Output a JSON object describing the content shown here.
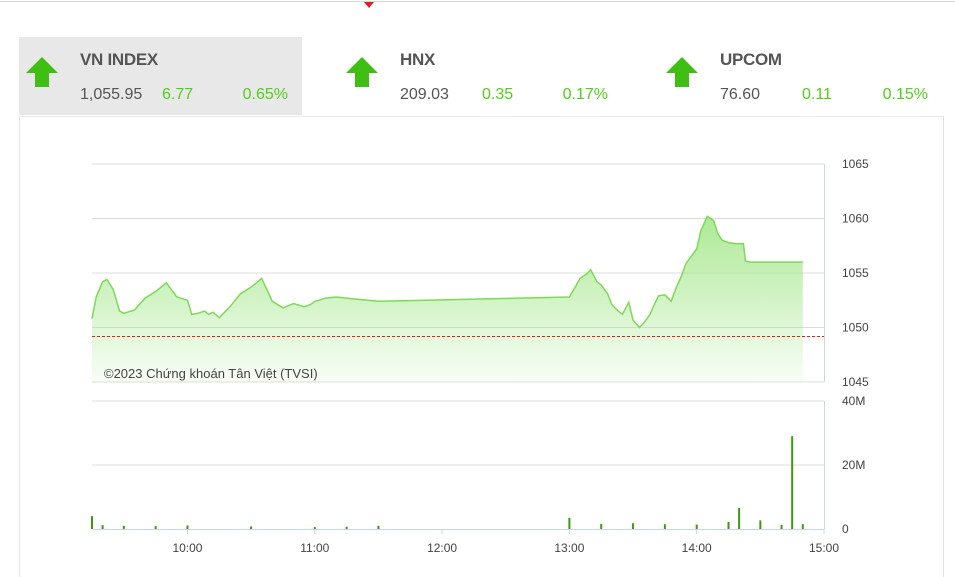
{
  "indices": [
    {
      "name": "VN INDEX",
      "value": "1,055.95",
      "change": "6.77",
      "percent": "0.65%",
      "direction": "up",
      "active": true
    },
    {
      "name": "HNX",
      "value": "209.03",
      "change": "0.35",
      "percent": "0.17%",
      "direction": "up",
      "active": false
    },
    {
      "name": "UPCOM",
      "value": "76.60",
      "change": "0.11",
      "percent": "0.15%",
      "direction": "up",
      "active": false
    }
  ],
  "colors": {
    "up": "#55cc1e",
    "arrow": "#3fbf12",
    "line": "#7ed957",
    "fill": "#c8f0b4",
    "reference": "#e02020",
    "volume": "#3a9a12"
  },
  "chart_data": [
    {
      "type": "area",
      "series_name": "VN INDEX",
      "x": [
        "09:15",
        "09:17",
        "09:20",
        "09:22",
        "09:25",
        "09:28",
        "09:30",
        "09:35",
        "09:40",
        "09:45",
        "09:50",
        "09:55",
        "10:00",
        "10:02",
        "10:05",
        "10:08",
        "10:10",
        "10:12",
        "10:15",
        "10:20",
        "10:25",
        "10:30",
        "10:35",
        "10:40",
        "10:45",
        "10:50",
        "10:55",
        "10:58",
        "11:00",
        "11:02",
        "11:05",
        "11:10",
        "11:15",
        "11:20",
        "11:25",
        "11:30",
        "13:00",
        "13:03",
        "13:05",
        "13:08",
        "13:10",
        "13:13",
        "13:15",
        "13:18",
        "13:20",
        "13:23",
        "13:25",
        "13:28",
        "13:30",
        "13:33",
        "13:35",
        "13:38",
        "13:40",
        "13:42",
        "13:45",
        "13:48",
        "13:50",
        "13:53",
        "13:55",
        "14:00",
        "14:02",
        "14:05",
        "14:08",
        "14:10",
        "14:12",
        "14:15",
        "14:18",
        "14:20",
        "14:22",
        "14:23",
        "14:25",
        "14:28",
        "14:30",
        "14:40",
        "14:45",
        "14:50"
      ],
      "y": [
        1050.8,
        1052.8,
        1054.2,
        1054.4,
        1053.5,
        1051.5,
        1051.3,
        1051.6,
        1052.7,
        1053.3,
        1054.1,
        1052.8,
        1052.5,
        1051.2,
        1051.3,
        1051.5,
        1051.2,
        1051.4,
        1050.9,
        1051.9,
        1053.1,
        1053.7,
        1054.5,
        1052.4,
        1051.8,
        1052.2,
        1051.9,
        1052.1,
        1052.4,
        1052.5,
        1052.7,
        1052.8,
        1052.7,
        1052.6,
        1052.5,
        1052.4,
        1052.8,
        1053.8,
        1054.5,
        1054.9,
        1055.3,
        1054.2,
        1053.9,
        1053.1,
        1052.1,
        1051.5,
        1051.2,
        1052.3,
        1050.7,
        1050.0,
        1050.4,
        1051.2,
        1052.1,
        1052.9,
        1053.0,
        1052.4,
        1053.5,
        1054.8,
        1055.9,
        1057.2,
        1058.9,
        1060.2,
        1059.8,
        1058.6,
        1058.0,
        1057.8,
        1057.7,
        1057.7,
        1057.7,
        1056.1,
        1056.0,
        1056.0,
        1056.0,
        1056.0,
        1056.0,
        1056.0
      ],
      "y_ticks": [
        1045,
        1050,
        1055,
        1060,
        1065
      ],
      "ylim": [
        1045,
        1065
      ],
      "reference_value": 1049.18,
      "x_ticks": [
        "10:00",
        "11:00",
        "12:00",
        "13:00",
        "14:00",
        "15:00"
      ],
      "annotation": "©2023 Chứng khoán Tân Việt (TVSI)",
      "grid": true
    },
    {
      "type": "bar",
      "series_name": "Volume",
      "y_ticks": [
        "0",
        "20M",
        "40M"
      ],
      "ylim": [
        0,
        40
      ],
      "unit": "M",
      "x": [
        "09:15",
        "09:20",
        "09:30",
        "09:45",
        "10:00",
        "10:30",
        "11:00",
        "11:15",
        "11:30",
        "13:00",
        "13:15",
        "13:30",
        "13:45",
        "14:00",
        "14:15",
        "14:20",
        "14:30",
        "14:40",
        "14:45",
        "14:50"
      ],
      "values": [
        4.0,
        1.2,
        1.0,
        0.9,
        1.1,
        0.8,
        0.6,
        0.7,
        1.0,
        3.5,
        1.6,
        1.8,
        1.5,
        1.4,
        2.2,
        6.6,
        2.7,
        1.3,
        29.0,
        1.5
      ]
    }
  ]
}
